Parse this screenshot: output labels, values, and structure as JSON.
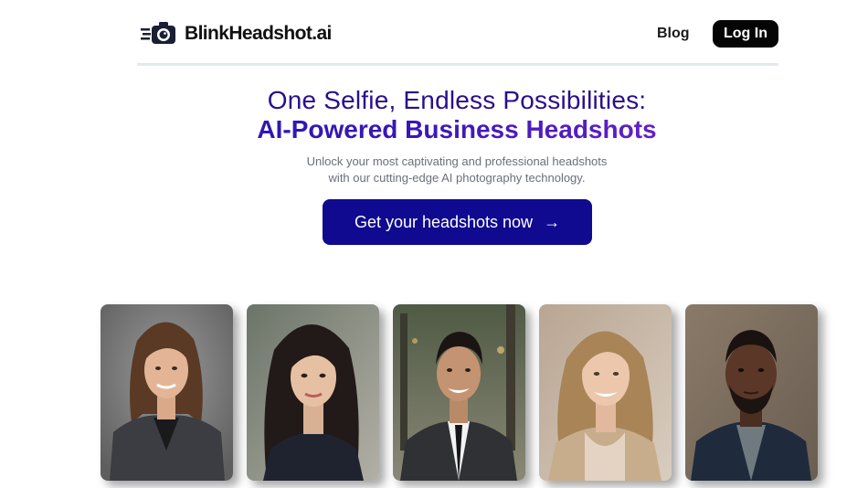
{
  "header": {
    "logo_text": "BlinkHeadshot.ai",
    "logo_icon": "camera-icon",
    "nav_blog": "Blog",
    "login_label": "Log In"
  },
  "hero": {
    "title_line1": "One Selfie, Endless Possibilities:",
    "title_line2": "AI-Powered Business Headshots",
    "subtitle_line1": "Unlock your most captivating and professional headshots",
    "subtitle_line2": "with our cutting-edge AI photography technology.",
    "cta_label": "Get your headshots now",
    "cta_icon": "arrow-right-icon"
  },
  "colors": {
    "primary": "#0f0a8f",
    "title_purple": "#2a0f8a",
    "gradient_end": "#8a2bd6",
    "login_bg": "#050505"
  },
  "gallery": [
    {
      "name": "headshot-woman-gray-blazer"
    },
    {
      "name": "headshot-woman-dark-hair"
    },
    {
      "name": "headshot-man-suit-outdoor"
    },
    {
      "name": "headshot-woman-blonde"
    },
    {
      "name": "headshot-man-beard"
    }
  ]
}
